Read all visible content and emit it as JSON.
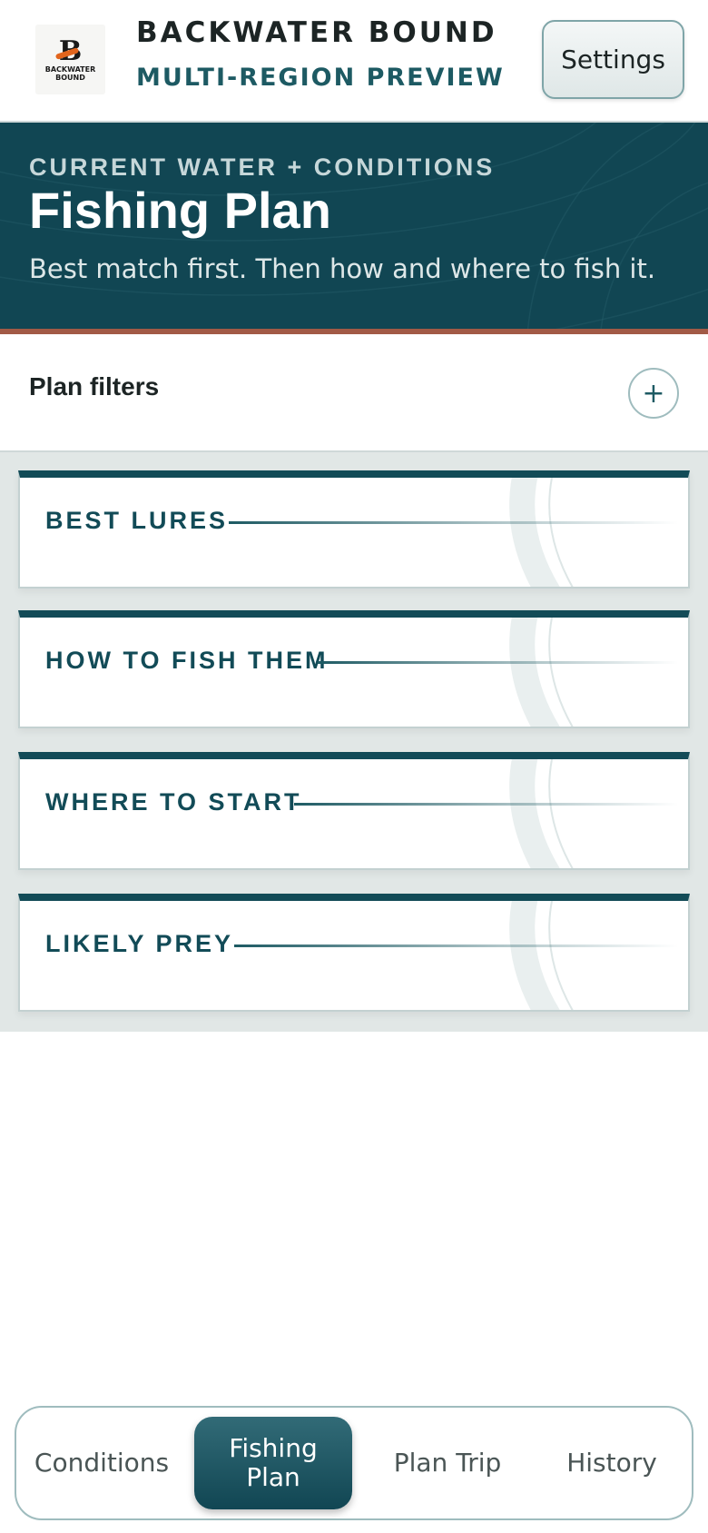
{
  "header": {
    "logo": {
      "mark": "B",
      "name_line1": "BACKWATER",
      "name_line2": "BOUND",
      "tagline": ""
    },
    "brand_title": "BACKWATER BOUND",
    "brand_subtitle": "MULTI-REGION PREVIEW",
    "settings_label": "Settings"
  },
  "hero": {
    "eyebrow": "CURRENT WATER + CONDITIONS",
    "title": "Fishing Plan",
    "description": "Best match first. Then how and where to fish it."
  },
  "filters": {
    "label": "Plan filters",
    "toggle_symbol": "+"
  },
  "cards": [
    {
      "title": "BEST LURES"
    },
    {
      "title": "HOW TO FISH THEM"
    },
    {
      "title": "WHERE TO START"
    },
    {
      "title": "LIKELY PREY"
    }
  ],
  "bottom_nav": {
    "items": [
      {
        "label": "Conditions"
      },
      {
        "label": "Fishing Plan"
      },
      {
        "label": "Plan Trip"
      },
      {
        "label": "History"
      }
    ],
    "active": "Fishing Plan"
  },
  "colors": {
    "primary": "#114653",
    "accent_rust": "#a25a46",
    "logo_orange": "#e2651d"
  },
  "icons": {
    "filters_toggle": "plus-icon"
  }
}
